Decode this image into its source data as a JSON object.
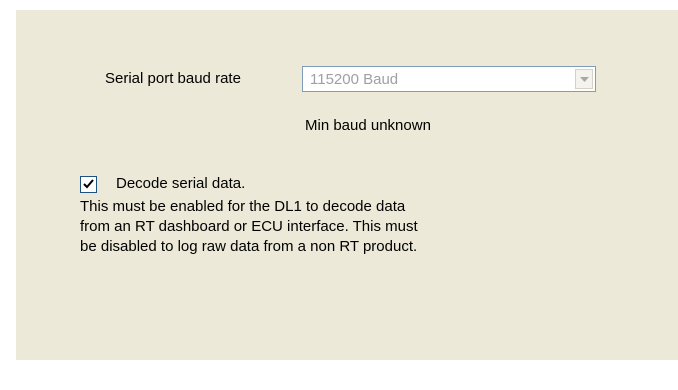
{
  "baud": {
    "label": "Serial port baud rate",
    "selected": "115200 Baud",
    "status": "Min baud unknown"
  },
  "decode": {
    "checked": true,
    "label": "Decode serial data.",
    "description_lines": [
      "This must be enabled for the DL1 to decode data",
      "from an RT dashboard or ECU interface. This must",
      "be disabled to log raw data from a non RT product."
    ]
  },
  "icons": {
    "dropdown": "chevron-down-icon",
    "check": "checkmark-icon"
  },
  "colors": {
    "panel_bg": "#ECE9D8",
    "disabled_text": "#A0A0A0",
    "field_border": "#7F9DB9",
    "checkbox_border": "#1C5180"
  }
}
